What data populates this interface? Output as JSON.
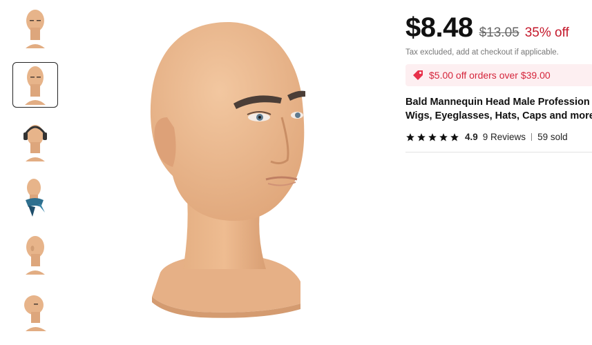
{
  "gallery": {
    "thumbnails": [
      {
        "icon": "mannequin-head-front",
        "selected": false
      },
      {
        "icon": "mannequin-head-three-quarter",
        "selected": true
      },
      {
        "icon": "mannequin-head-with-headphones",
        "selected": false
      },
      {
        "icon": "mannequin-head-with-scarf",
        "selected": false
      },
      {
        "icon": "mannequin-head-side",
        "selected": false
      },
      {
        "icon": "mannequin-head-tilted",
        "selected": false
      }
    ],
    "main_image_icon": "mannequin-head-main"
  },
  "product": {
    "price": "$8.48",
    "original_price": "$13.05",
    "discount": "35% off",
    "tax_note": "Tax excluded, add at checkout if applicable.",
    "coupon": "$5.00 off orders over $39.00",
    "title_line1": "Bald Mannequin Head Male Profession",
    "title_line2": "Wigs, Eyeglasses, Hats, Caps and more",
    "rating": "4.9",
    "stars": 5,
    "reviews": "9 Reviews",
    "sold": "59 sold"
  },
  "colors": {
    "price": "#111111",
    "discount": "#c4182b",
    "coupon_bg": "#fdeff1",
    "coupon_text": "#d5253b",
    "skin": "#e9b98e"
  }
}
